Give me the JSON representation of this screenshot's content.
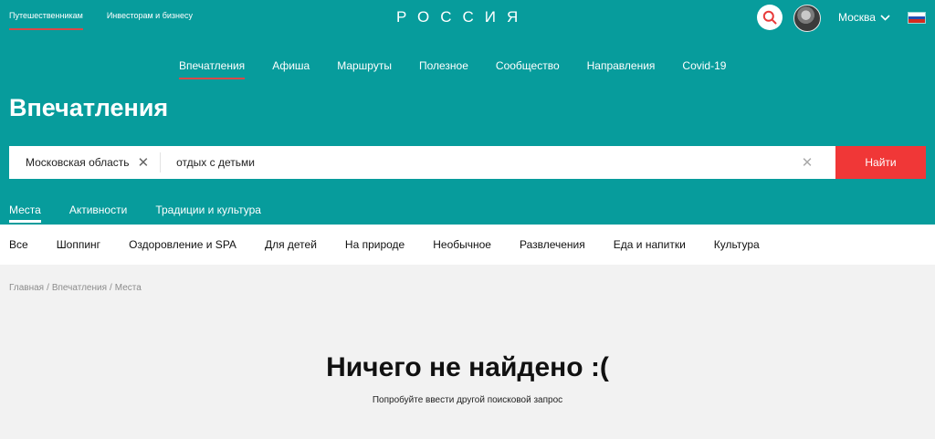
{
  "header": {
    "audience": [
      {
        "label": "Путешественникам",
        "active": true
      },
      {
        "label": "Инвесторам и бизнесу",
        "active": false
      }
    ],
    "logo": "РОССИЯ",
    "search_icon": "search-icon",
    "city": "Москва",
    "flag_colors": [
      "#ffffff",
      "#1f4fb4",
      "#d52b1e"
    ]
  },
  "nav": {
    "items": [
      {
        "label": "Впечатления",
        "active": true
      },
      {
        "label": "Афиша"
      },
      {
        "label": "Маршруты"
      },
      {
        "label": "Полезное"
      },
      {
        "label": "Сообщество"
      },
      {
        "label": "Направления"
      },
      {
        "label": "Covid-19"
      }
    ]
  },
  "page": {
    "title": "Впечатления"
  },
  "search": {
    "region": "Московская область",
    "query": "отдых с детьми",
    "button": "Найти"
  },
  "subtabs": [
    {
      "label": "Места",
      "active": true
    },
    {
      "label": "Активности"
    },
    {
      "label": "Традиции и культура"
    }
  ],
  "categories": [
    "Все",
    "Шоппинг",
    "Оздоровление и SPA",
    "Для детей",
    "На природе",
    "Необычное",
    "Развлечения",
    "Еда и напитки",
    "Культура"
  ],
  "breadcrumb": [
    "Главная",
    "Впечатления",
    "Места"
  ],
  "empty": {
    "title": "Ничего не найдено :(",
    "hint": "Попробуйте ввести другой поисковой запрос"
  },
  "colors": {
    "brand": "#079c9c",
    "accent": "#f03737",
    "underline": "#d94848",
    "background": "#f2f2f2"
  }
}
